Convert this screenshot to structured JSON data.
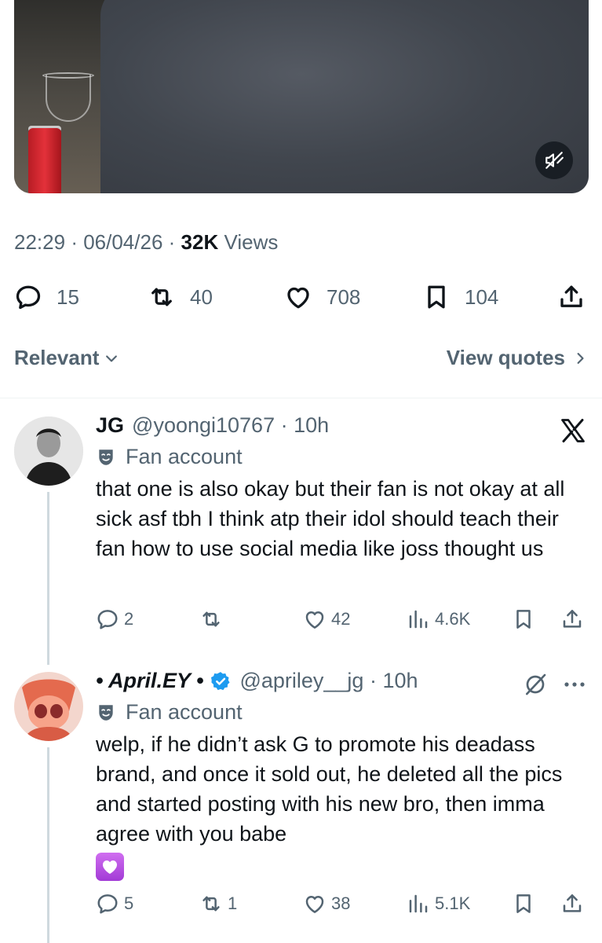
{
  "post": {
    "time": "22:29",
    "date": "06/04/26",
    "views_count": "32K",
    "views_label": "Views",
    "actions": {
      "replies": "15",
      "reposts": "40",
      "likes": "708",
      "bookmarks": "104"
    }
  },
  "sort": {
    "label": "Relevant",
    "view_quotes": "View quotes"
  },
  "replies": [
    {
      "name": "JG",
      "handle": "@yoongi10767",
      "time": "10h",
      "label": "Fan account",
      "text": "that one is also okay but their fan is not okay at all sick asf tbh I think atp their idol should teach their fan how to use social media like joss thought us",
      "replies": "2",
      "reposts": "",
      "likes": "42",
      "views": "4.6K"
    },
    {
      "name": "• April.EY •",
      "handle": "@apriley__jg",
      "time": "10h",
      "label": "Fan account",
      "text": "welp, if he didn’t ask G to promote his deadass brand, and once it sold out, he deleted all the pics and started posting with his new bro, then imma agree with you babe",
      "replies": "5",
      "reposts": "1",
      "likes": "38",
      "views": "5.1K"
    }
  ],
  "icons": {
    "mute": "speaker-muted-icon",
    "reply": "speech-bubble-icon",
    "repost": "repost-arrows-icon",
    "like": "heart-icon",
    "bookmark": "bookmark-icon",
    "share": "share-upload-icon",
    "views": "bar-chart-icon",
    "x_logo": "x-logo-icon",
    "verified": "verified-badge-icon",
    "grok": "grok-slash-icon",
    "more": "more-dots-icon",
    "fan_label": "theater-mask-icon",
    "emoji": "purple-heart-emoji"
  },
  "colors": {
    "text": "#0f1419",
    "muted": "#536471",
    "verified": "#1d9bf0"
  }
}
